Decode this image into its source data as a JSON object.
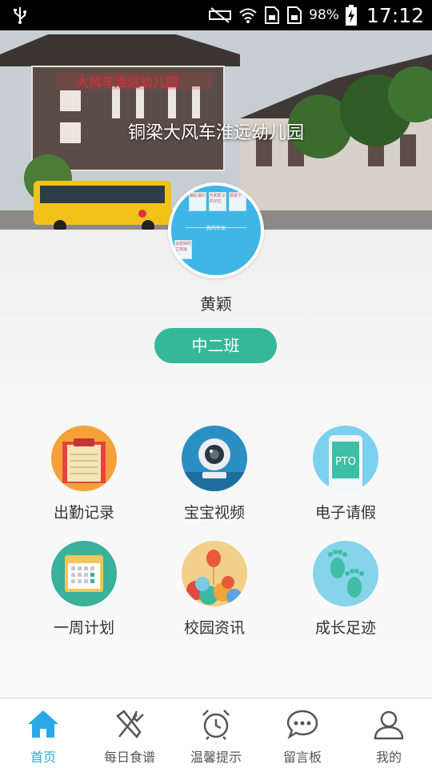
{
  "status_bar": {
    "battery": "98%",
    "time": "17:12"
  },
  "school": {
    "name": "铜梁大风车淮远幼儿园",
    "building_sign": "大风车淮远幼儿园"
  },
  "avatar": {
    "cards": [
      "罐彩漏印",
      "光和影子的记忆",
      "猜猜下",
      "会旋转的立体画"
    ],
    "caption": "我的作品"
  },
  "child": {
    "name": "黄颖",
    "class_name": "中二班"
  },
  "features": [
    {
      "label": "出勤记录",
      "icon": "clipboard-icon"
    },
    {
      "label": "宝宝视频",
      "icon": "webcam-icon"
    },
    {
      "label": "电子请假",
      "icon": "phone-pto-icon",
      "icon_text": "PTO"
    },
    {
      "label": "一周计划",
      "icon": "calendar-icon"
    },
    {
      "label": "校园资讯",
      "icon": "balloons-icon"
    },
    {
      "label": "成长足迹",
      "icon": "footprints-icon"
    }
  ],
  "nav": [
    {
      "label": "首页",
      "icon": "home-icon",
      "active": true
    },
    {
      "label": "每日食谱",
      "icon": "fork-knife-icon"
    },
    {
      "label": "温馨提示",
      "icon": "alarm-clock-icon"
    },
    {
      "label": "留言板",
      "icon": "chat-bubble-icon"
    },
    {
      "label": "我的",
      "icon": "user-icon"
    }
  ],
  "colors": {
    "accent": "#29a9e6",
    "class_pill": "#35b89a"
  }
}
